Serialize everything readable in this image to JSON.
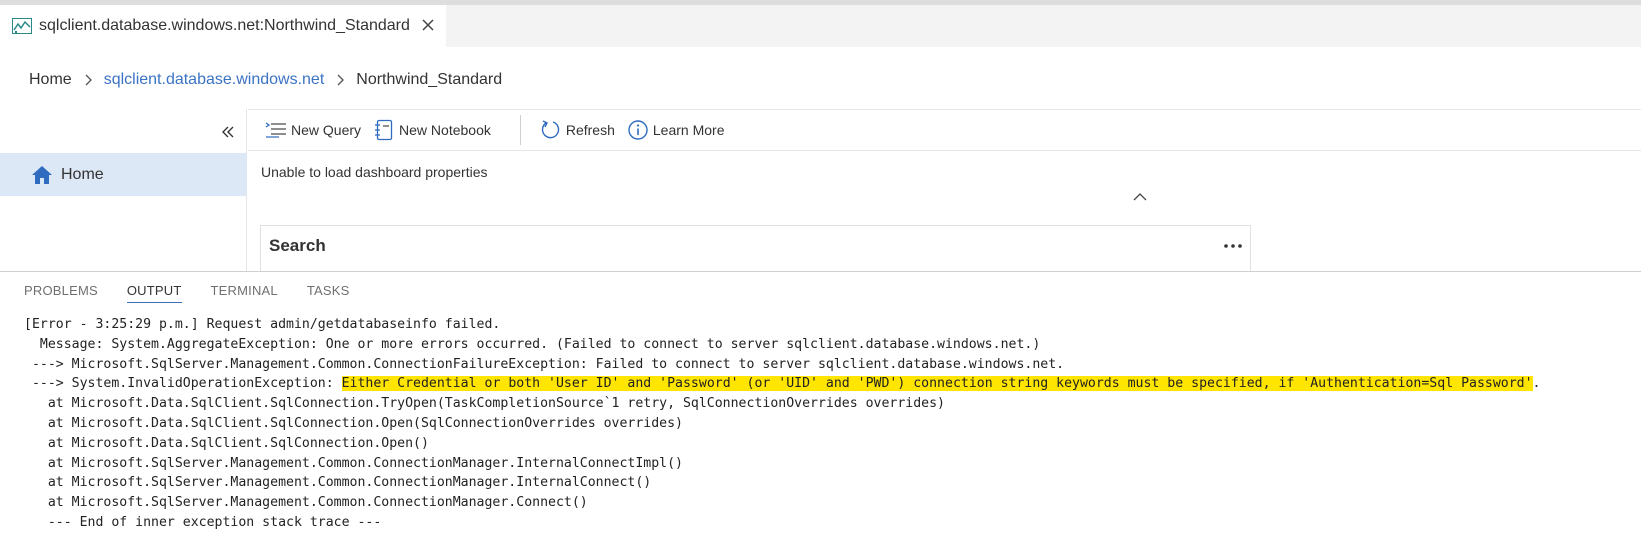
{
  "tab": {
    "icon": "dashboard-icon",
    "title": "sqlclient.database.windows.net:Northwind_Standard",
    "close_icon": "close-icon"
  },
  "breadcrumb": {
    "items": [
      "Home",
      "sqlclient.database.windows.net",
      "Northwind_Standard"
    ]
  },
  "sidebar": {
    "collapse_icon": "double-chevron-left-icon",
    "items": [
      {
        "label": "Home",
        "icon": "home-icon"
      }
    ]
  },
  "toolbar": {
    "new_query": "New Query",
    "new_notebook": "New Notebook",
    "refresh": "Refresh",
    "learn_more": "Learn More"
  },
  "dashboard": {
    "message": "Unable to load dashboard properties",
    "search_title": "Search"
  },
  "panel": {
    "tabs": [
      "PROBLEMS",
      "OUTPUT",
      "TERMINAL",
      "TASKS"
    ],
    "active_tab": "OUTPUT",
    "lines": [
      {
        "text": "[Error - 3:25:29 p.m.] Request admin/getdatabaseinfo failed."
      },
      {
        "text": "  Message: System.AggregateException: One or more errors occurred. (Failed to connect to server sqlclient.database.windows.net.)"
      },
      {
        "text": " ---> Microsoft.SqlServer.Management.Common.ConnectionFailureException: Failed to connect to server sqlclient.database.windows.net."
      },
      {
        "prefix": " ---> System.InvalidOperationException: ",
        "highlight": "Either Credential or both 'User ID' and 'Password' (or 'UID' and 'PWD') connection string keywords must be specified, if 'Authentication=Sql Password'",
        "suffix": "."
      },
      {
        "text": "   at Microsoft.Data.SqlClient.SqlConnection.TryOpen(TaskCompletionSource`1 retry, SqlConnectionOverrides overrides)"
      },
      {
        "text": "   at Microsoft.Data.SqlClient.SqlConnection.Open(SqlConnectionOverrides overrides)"
      },
      {
        "text": "   at Microsoft.Data.SqlClient.SqlConnection.Open()"
      },
      {
        "text": "   at Microsoft.SqlServer.Management.Common.ConnectionManager.InternalConnectImpl()"
      },
      {
        "text": "   at Microsoft.SqlServer.Management.Common.ConnectionManager.InternalConnect()"
      },
      {
        "text": "   at Microsoft.SqlServer.Management.Common.ConnectionManager.Connect()"
      },
      {
        "text": "   --- End of inner exception stack trace ---"
      }
    ],
    "highlight_color": "#ffe500"
  },
  "colors": {
    "accent": "#3b73c4",
    "sidebar_selected": "#dde8f6"
  }
}
